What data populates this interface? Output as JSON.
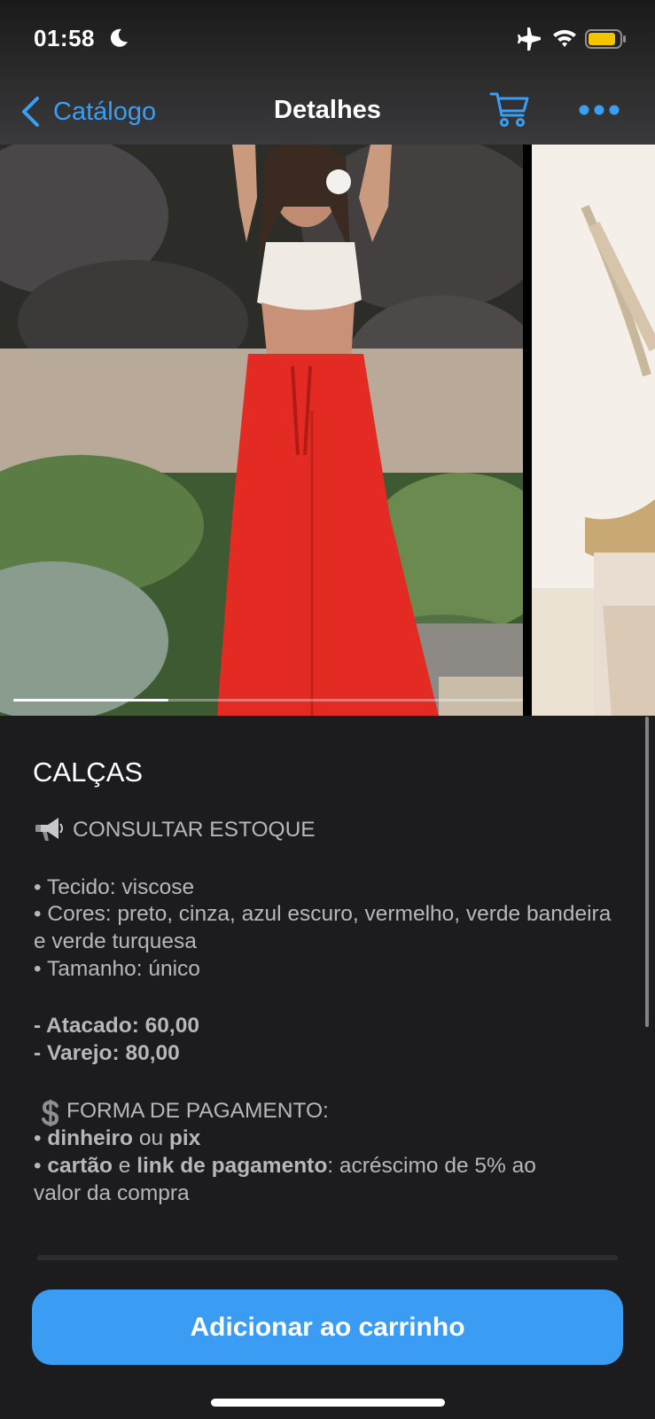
{
  "status_bar": {
    "time": "01:58",
    "icons": [
      "moon-icon",
      "airplane-mode-icon",
      "wifi-icon",
      "battery-icon"
    ],
    "battery_color": "#f5c400"
  },
  "nav": {
    "back_label": "Catálogo",
    "title": "Detalhes",
    "icons": [
      "chevron-left-icon",
      "cart-icon",
      "more-icon"
    ],
    "accent_color": "#3b9ef5"
  },
  "carousel": {
    "photos": [
      "red-wide-leg-pants-photo",
      "pampas-grass-decor-photo"
    ],
    "active_index": 0
  },
  "product": {
    "title": "CALÇAS",
    "stock_line": "CONSULTAR ESTOQUE",
    "details": {
      "fabric": "• Tecido: viscose",
      "colors": "• Cores: preto, cinza, azul escuro, vermelho, verde bandeira e verde turquesa",
      "size": "• Tamanho: único"
    },
    "prices": {
      "wholesale": "- Atacado: 60,00",
      "retail": "- Varejo: 80,00"
    },
    "payment": {
      "heading": "FORMA DE PAGAMENTO:",
      "bullet": "•",
      "line1_a": "dinheiro",
      "line1_b": " ou ",
      "line1_c": "pix",
      "line2_a": "cartão",
      "line2_b": " e ",
      "line2_c": "link de pagamento",
      "line2_d": ": acréscimo de 5% ao",
      "line3": "valor da compra"
    }
  },
  "cta": {
    "label": "Adicionar ao carrinho",
    "color": "#3a9cf2"
  }
}
